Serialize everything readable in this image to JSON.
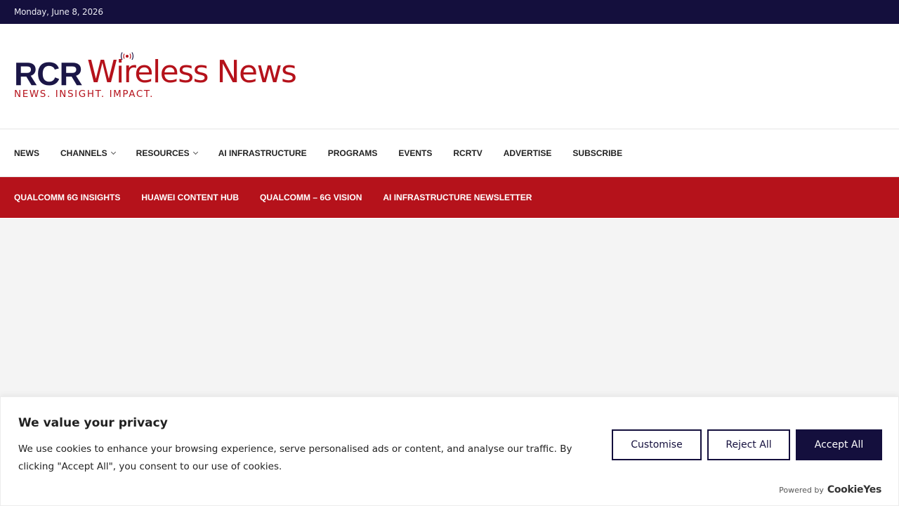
{
  "topbar": {
    "date": "Monday, June 8, 2026"
  },
  "logo": {
    "rcr": "RCR",
    "wireless_news": "Wireless News",
    "tagline": "NEWS. INSIGHT. IMPACT.",
    "colors": {
      "navy": "#1b1647",
      "red": "#b5121b"
    }
  },
  "mainnav": {
    "items": [
      {
        "label": "NEWS",
        "has_dropdown": false
      },
      {
        "label": "CHANNELS",
        "has_dropdown": true
      },
      {
        "label": "RESOURCES",
        "has_dropdown": true
      },
      {
        "label": "AI INFRASTRUCTURE",
        "has_dropdown": false
      },
      {
        "label": "PROGRAMS",
        "has_dropdown": false
      },
      {
        "label": "EVENTS",
        "has_dropdown": false
      },
      {
        "label": "RCRTV",
        "has_dropdown": false
      },
      {
        "label": "ADVERTISE",
        "has_dropdown": false
      },
      {
        "label": "SUBSCRIBE",
        "has_dropdown": false
      }
    ]
  },
  "subnav": {
    "background": "#b5121b",
    "items": [
      "QUALCOMM 6G INSIGHTS",
      "HUAWEI CONTENT HUB",
      "QUALCOMM – 6G VISION",
      "AI INFRASTRUCTURE NEWSLETTER"
    ]
  },
  "cookie_banner": {
    "title": "We value your privacy",
    "description": "We use cookies to enhance your browsing experience, serve personalised ads or content, and analyse our traffic. By clicking \"Accept All\", you consent to our use of cookies.",
    "buttons": {
      "customise": "Customise",
      "reject": "Reject All",
      "accept": "Accept All"
    },
    "powered_by": "Powered by",
    "brand": "CookieYes",
    "accent": "#140f3d"
  }
}
